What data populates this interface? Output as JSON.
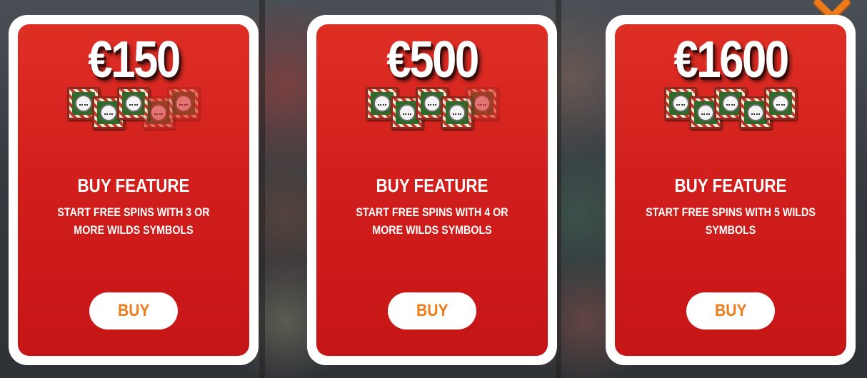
{
  "close": {
    "icon": "close-icon"
  },
  "cards": [
    {
      "price": "€150",
      "title": "BUY FEATURE",
      "description": "START FREE SPINS WITH 3 OR MORE WILDS SYMBOLS",
      "button": "BUY",
      "wild_symbols_total": 5,
      "wild_symbols_active": 3
    },
    {
      "price": "€500",
      "title": "BUY FEATURE",
      "description": "START FREE SPINS WITH 4 OR MORE WILDS SYMBOLS",
      "button": "BUY",
      "wild_symbols_total": 5,
      "wild_symbols_active": 4
    },
    {
      "price": "€1600",
      "title": "BUY FEATURE",
      "description": "START FREE SPINS WITH 5 WILDS SYMBOLS",
      "button": "BUY",
      "wild_symbols_total": 5,
      "wild_symbols_active": 5
    }
  ],
  "colors": {
    "card_red": "#d21f1c",
    "button_text_orange": "#ef7b17",
    "close_orange": "#ee7a1a"
  }
}
